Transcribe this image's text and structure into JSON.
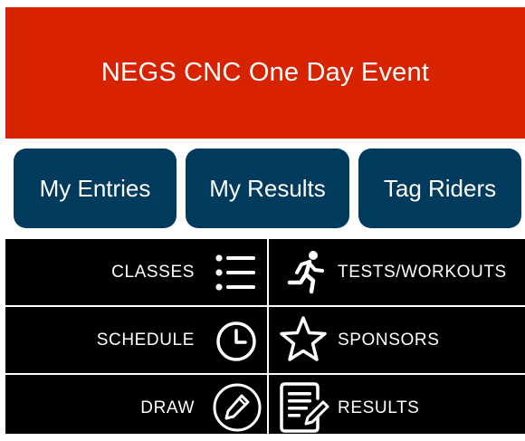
{
  "header": {
    "title": "NEGS CNC One Day Event",
    "color": "#d72300"
  },
  "buttons": {
    "color": "#003a5c",
    "items": [
      {
        "label": "My Entries"
      },
      {
        "label": "My Results"
      },
      {
        "label": "Tag Riders"
      }
    ]
  },
  "menu": {
    "background": "#000000",
    "items": [
      {
        "label": "CLASSES",
        "icon": "list-icon"
      },
      {
        "label": "TESTS/WORKOUTS",
        "icon": "running-person-icon"
      },
      {
        "label": "SCHEDULE",
        "icon": "clock-icon"
      },
      {
        "label": "SPONSORS",
        "icon": "star-icon"
      },
      {
        "label": "DRAW",
        "icon": "pencil-circle-icon"
      },
      {
        "label": "RESULTS",
        "icon": "document-edit-icon"
      }
    ]
  }
}
